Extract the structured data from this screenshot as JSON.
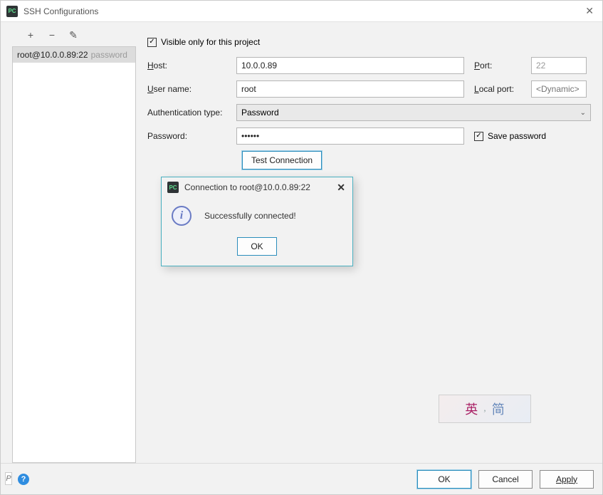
{
  "window": {
    "title": "SSH Configurations",
    "app_icon_text": "PC"
  },
  "toolbar": {
    "add_icon": "+",
    "remove_icon": "−",
    "edit_icon": "✎"
  },
  "sidebar": {
    "items": [
      {
        "label": "root@10.0.0.89:22",
        "suffix": "password"
      }
    ]
  },
  "form": {
    "visible_only_label": "Visible only for this project",
    "visible_only_checked": "✓",
    "host_label": "Host:",
    "host_value": "10.0.0.89",
    "port_label": "Port:",
    "port_value": "22",
    "user_label": "User name:",
    "user_value": "root",
    "localport_label": "Local port:",
    "localport_placeholder": "<Dynamic>",
    "auth_label": "Authentication type:",
    "auth_value": "Password",
    "password_label": "Password:",
    "password_value": "••••••",
    "save_password_label": "Save password",
    "save_password_checked": "✓",
    "test_button": "Test Connection"
  },
  "dialog": {
    "title": "Connection to root@10.0.0.89:22",
    "message": "Successfully connected!",
    "ok": "OK",
    "app_icon_text": "PC"
  },
  "ime": {
    "a": "英",
    "b": ",",
    "c": "简"
  },
  "footer": {
    "help": "?",
    "p": "P",
    "ok": "OK",
    "cancel": "Cancel",
    "apply": "Apply"
  }
}
